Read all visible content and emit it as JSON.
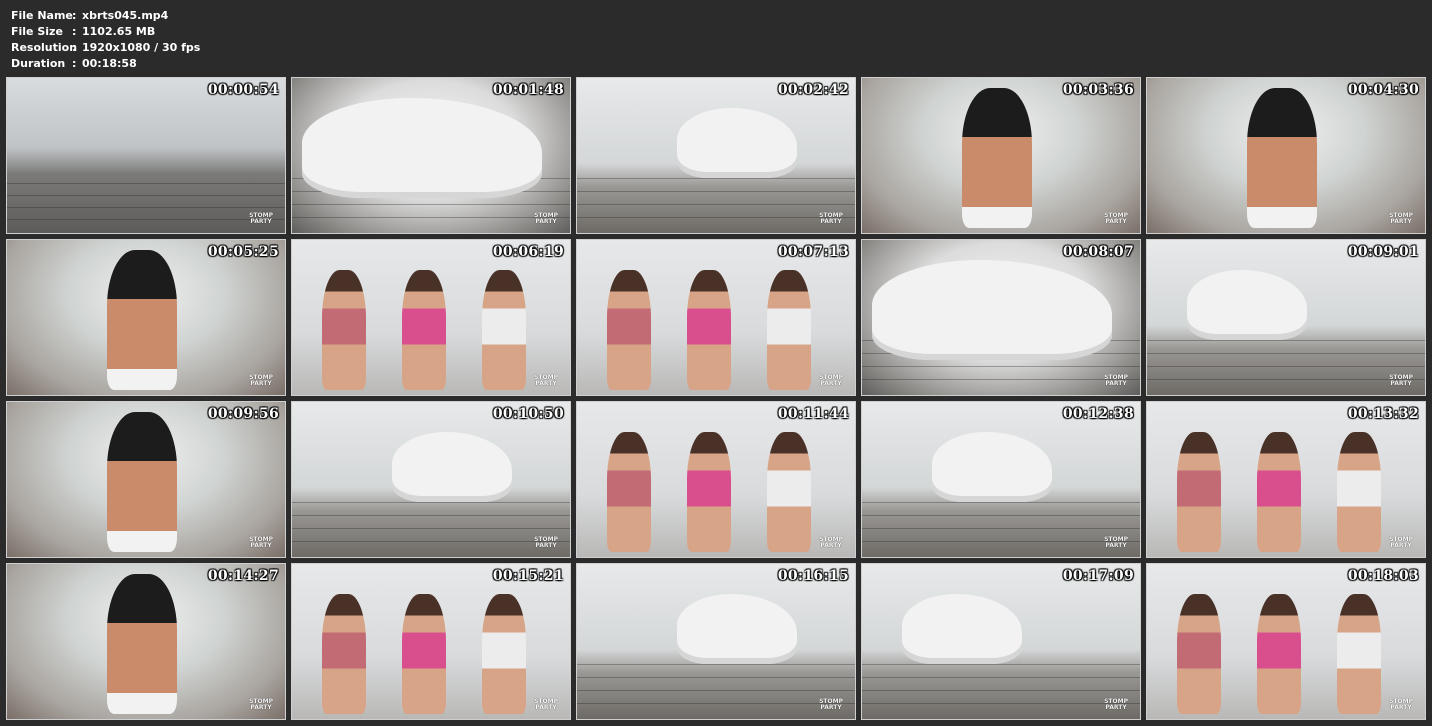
{
  "file_info": {
    "rows": [
      {
        "key": "File Name",
        "sep": ":",
        "value": "xbrts045.mp4"
      },
      {
        "key": "File Size",
        "sep": ":",
        "value": "1102.65 MB"
      },
      {
        "key": "Resolution",
        "sep": ":",
        "value": "1920x1080 / 30 fps"
      },
      {
        "key": "Duration",
        "sep": ":",
        "value": "00:18:58"
      }
    ]
  },
  "watermark": {
    "line1": "STOMP",
    "line2": "PARTY"
  },
  "thumbnails": [
    {
      "timestamp": "00:00:54",
      "scene": "light"
    },
    {
      "timestamp": "00:01:48",
      "scene": "white"
    },
    {
      "timestamp": "00:02:42",
      "scene": "room"
    },
    {
      "timestamp": "00:03:36",
      "scene": "up"
    },
    {
      "timestamp": "00:04:30",
      "scene": "up"
    },
    {
      "timestamp": "00:05:25",
      "scene": "up"
    },
    {
      "timestamp": "00:06:19",
      "scene": "people"
    },
    {
      "timestamp": "00:07:13",
      "scene": "people"
    },
    {
      "timestamp": "00:08:07",
      "scene": "white"
    },
    {
      "timestamp": "00:09:01",
      "scene": "room"
    },
    {
      "timestamp": "00:09:56",
      "scene": "up"
    },
    {
      "timestamp": "00:10:50",
      "scene": "room"
    },
    {
      "timestamp": "00:11:44",
      "scene": "people"
    },
    {
      "timestamp": "00:12:38",
      "scene": "room"
    },
    {
      "timestamp": "00:13:32",
      "scene": "people"
    },
    {
      "timestamp": "00:14:27",
      "scene": "up"
    },
    {
      "timestamp": "00:15:21",
      "scene": "people"
    },
    {
      "timestamp": "00:16:15",
      "scene": "room"
    },
    {
      "timestamp": "00:17:09",
      "scene": "room"
    },
    {
      "timestamp": "00:18:03",
      "scene": "people"
    }
  ]
}
